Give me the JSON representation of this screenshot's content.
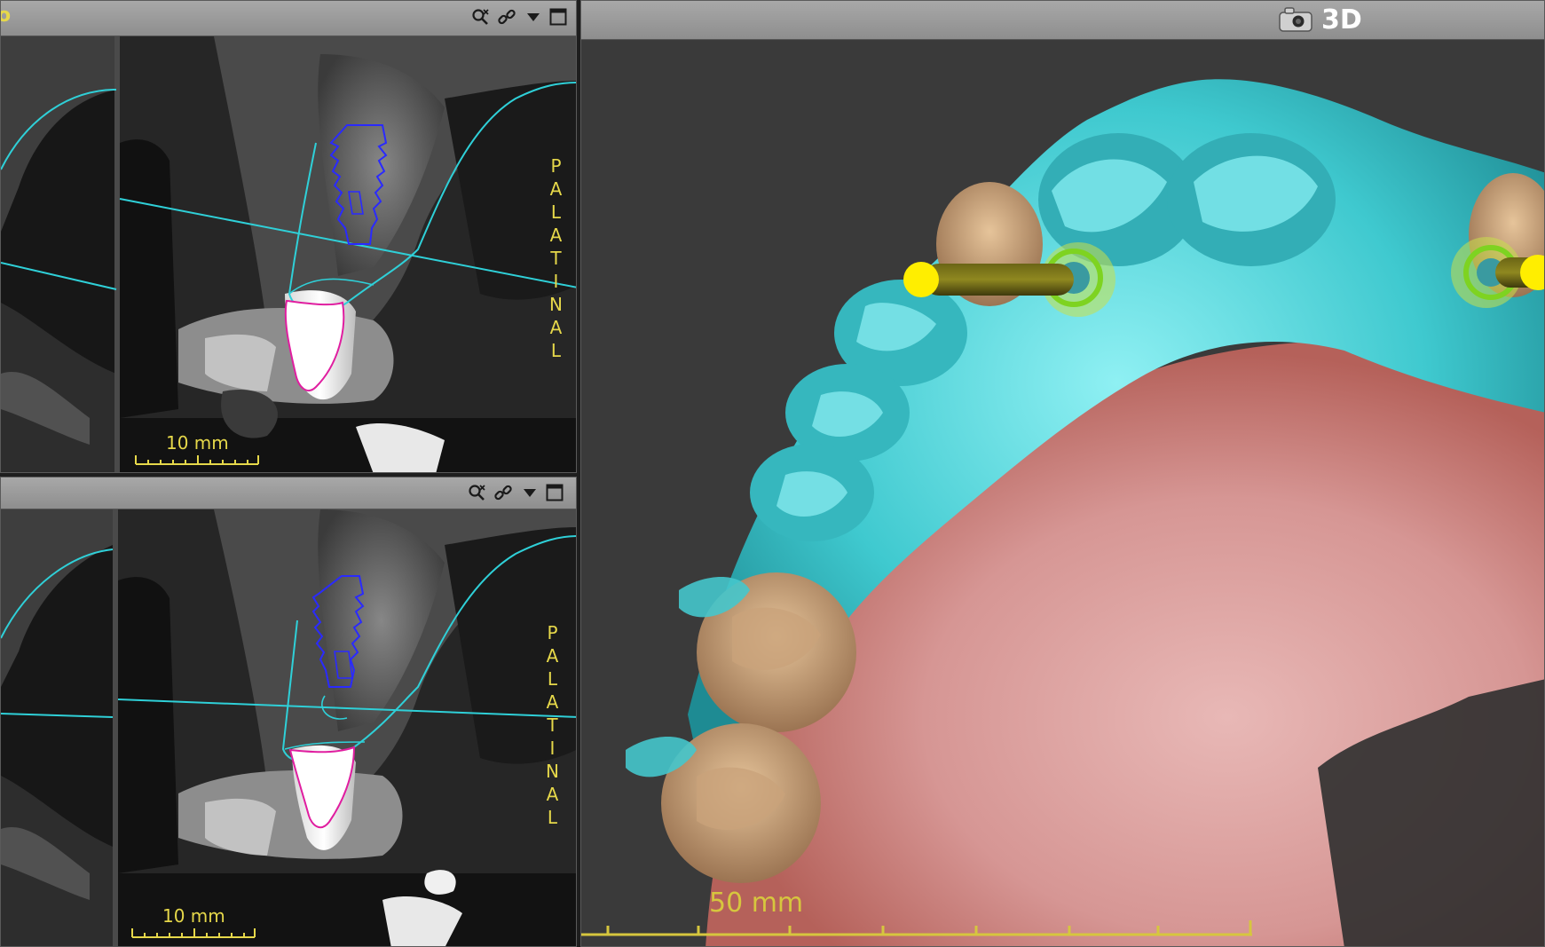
{
  "views": {
    "top_slice": {
      "title_fragment": "o",
      "orientation_label": "PALATINAL",
      "scale_label": "10 mm"
    },
    "bottom_slice": {
      "orientation_label": "PALATINAL",
      "scale_label": "10 mm"
    },
    "view3d": {
      "title": "3D",
      "scale_label": "50 mm"
    }
  },
  "toolbar_icons": [
    "zoom-reset-icon",
    "link-icon",
    "dropdown-arrow-icon",
    "maximize-window-icon"
  ],
  "colors": {
    "cyan_contour": "#2fd0d8",
    "implant_outline": "#2a2aff",
    "tooth_outline": "#e01ea0",
    "annotation_yellow": "#e6d84a",
    "scan_cyan": "#49d6dc",
    "gingiva": "#c97a6e",
    "implant_marker": "#ffee00"
  }
}
